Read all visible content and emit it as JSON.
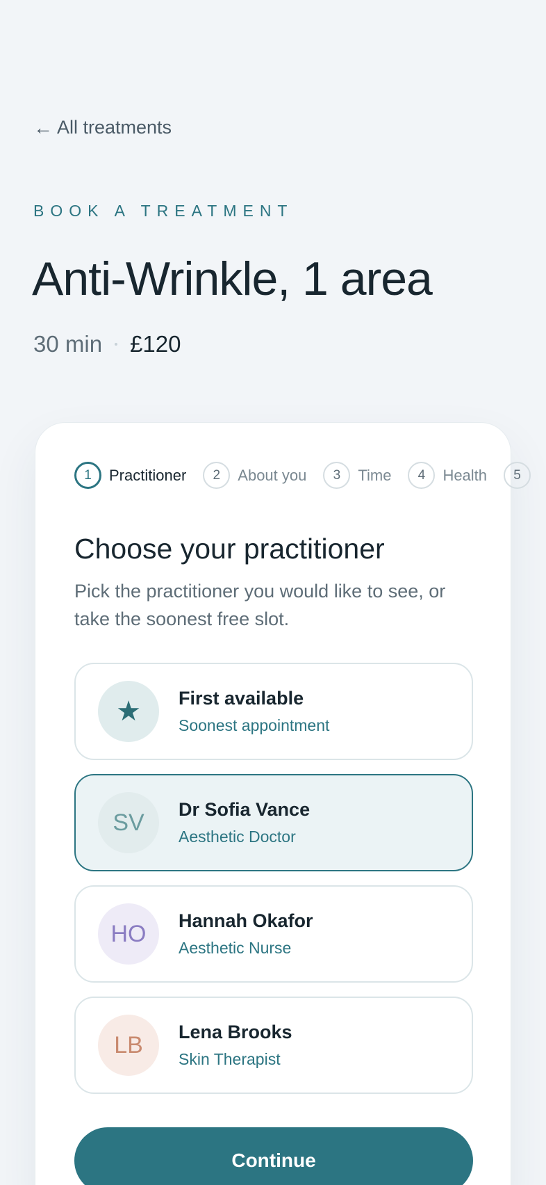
{
  "back_link": {
    "arrow": "←",
    "label": "All treatments"
  },
  "eyebrow": "BOOK A TREATMENT",
  "treatment": {
    "title": "Anti-Wrinkle, 1 area",
    "duration": "30 min",
    "price": "£120"
  },
  "steps": [
    {
      "num": "1",
      "label": "Practitioner",
      "active": true
    },
    {
      "num": "2",
      "label": "About you"
    },
    {
      "num": "3",
      "label": "Time"
    },
    {
      "num": "4",
      "label": "Health"
    },
    {
      "num": "5",
      "label": ""
    }
  ],
  "section": {
    "title": "Choose your practitioner",
    "description": "Pick the practitioner you would like to see, or take the soonest free slot."
  },
  "options": [
    {
      "initials": "★",
      "icon": "star-icon",
      "name": "First available",
      "subtitle": "Soonest appointment",
      "avatar_bg": "#e0eced",
      "avatar_fg": "#2c6e76",
      "selected": false
    },
    {
      "initials": "SV",
      "name": "Dr Sofia Vance",
      "subtitle": "Aesthetic Doctor",
      "avatar_bg": "#e2eced",
      "avatar_fg": "#6b9c9f",
      "selected": true
    },
    {
      "initials": "HO",
      "name": "Hannah Okafor",
      "subtitle": "Aesthetic Nurse",
      "avatar_bg": "#eeebf7",
      "avatar_fg": "#8a7cc2",
      "selected": false
    },
    {
      "initials": "LB",
      "name": "Lena Brooks",
      "subtitle": "Skin Therapist",
      "avatar_bg": "#f8ebe6",
      "avatar_fg": "#c98a6f",
      "selected": false
    }
  ],
  "continue_label": "Continue",
  "colors": {
    "accent": "#2c7582",
    "background": "#f2f5f8"
  }
}
